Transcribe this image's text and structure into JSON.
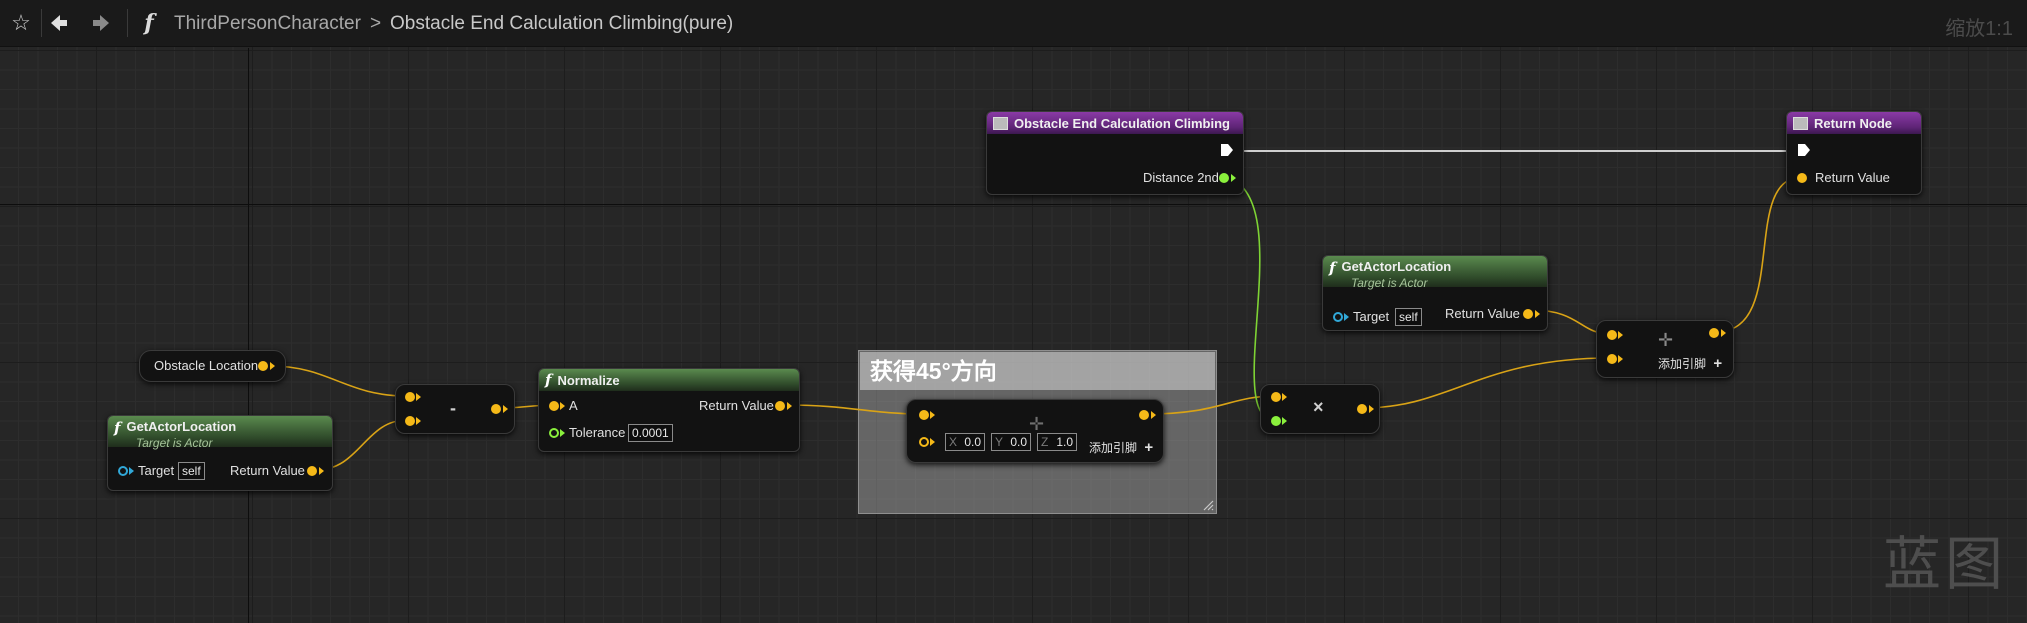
{
  "toolbar": {
    "breadcrumb_class": "ThirdPersonCharacter",
    "breadcrumb_separator": ">",
    "breadcrumb_function": "Obstacle End Calculation Climbing(pure)",
    "zoom_label": "缩放1:1"
  },
  "nodes": {
    "entry": {
      "title": "Obstacle End Calculation Climbing",
      "output_label": "Distance 2nd"
    },
    "return": {
      "title": "Return Node",
      "input_label": "Return Value"
    },
    "get_actor_location_top": {
      "title": "GetActorLocation",
      "subtitle": "Target is Actor",
      "target_label": "Target",
      "target_value": "self",
      "return_label": "Return Value"
    },
    "get_actor_location_left": {
      "title": "GetActorLocation",
      "subtitle": "Target is Actor",
      "target_label": "Target",
      "target_value": "self",
      "return_label": "Return Value"
    },
    "obstacle_location": {
      "label": "Obstacle Location"
    },
    "subtract": {
      "symbol": "-"
    },
    "normalize": {
      "title": "Normalize",
      "input_a_label": "A",
      "tolerance_label": "Tolerance",
      "tolerance_value": "0.0001",
      "return_label": "Return Value"
    },
    "rotate_node": {
      "x_label": "X",
      "x_value": "0.0",
      "y_label": "Y",
      "y_value": "0.0",
      "z_label": "Z",
      "z_value": "1.0",
      "add_pin_label": "添加引脚",
      "add_pin_symbol": "+"
    },
    "multiply": {
      "symbol": "×"
    },
    "add": {
      "add_pin_label": "添加引脚",
      "add_pin_symbol": "+"
    }
  },
  "comment": {
    "title": "获得45°方向"
  },
  "watermark": {
    "text": "蓝图"
  },
  "colors": {
    "vector_pin": "#f5b918",
    "float_pin": "#8af03c",
    "object_pin": "#31a8d8",
    "exec_wire": "#cfcfcf",
    "function_header": "#4d7a43",
    "event_header": "#7a2e96"
  }
}
